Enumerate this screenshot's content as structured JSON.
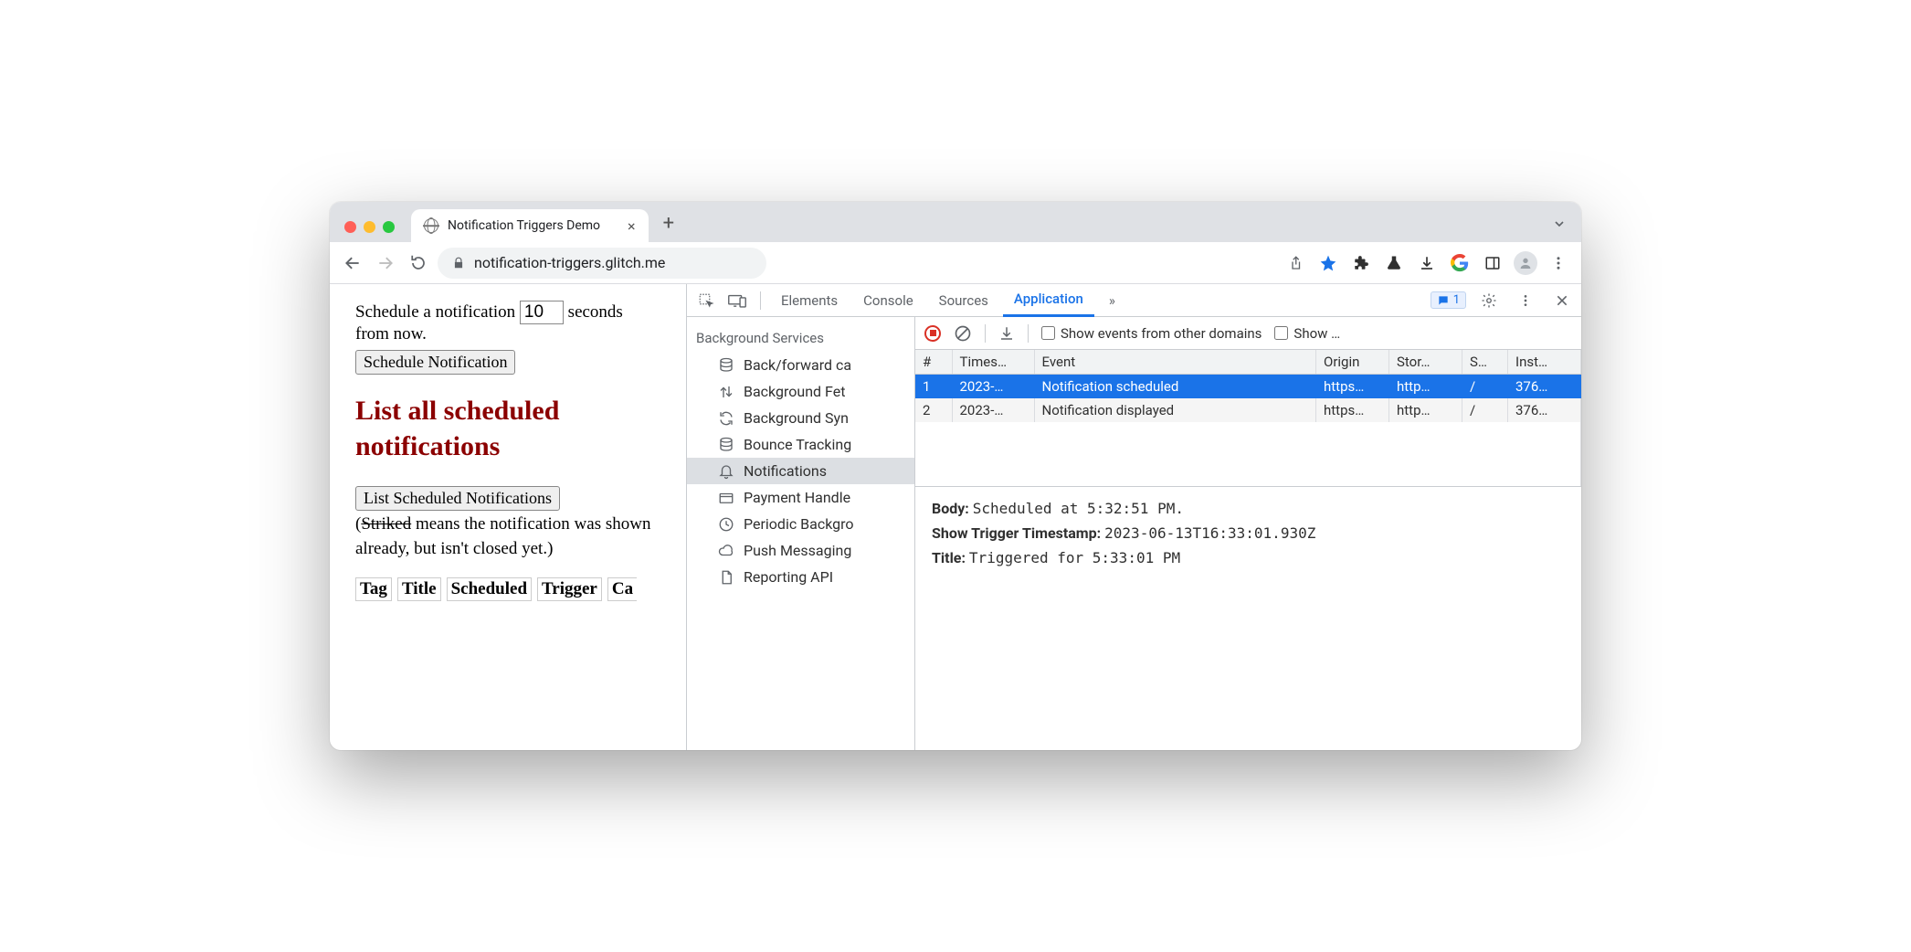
{
  "browser": {
    "tab_title": "Notification Triggers Demo",
    "url": "notification-triggers.glitch.me"
  },
  "page": {
    "schedule_label_a": "Schedule a notification ",
    "schedule_seconds": "10",
    "schedule_label_b": " seconds from now.",
    "schedule_button": "Schedule Notification",
    "heading": "List all scheduled notifications",
    "list_button": "List Scheduled Notifications",
    "hint_open": "(",
    "hint_striked": "Striked",
    "hint_rest": " means the notification was shown already, but isn't closed yet.)",
    "table_headers": [
      "Tag",
      "Title",
      "Scheduled",
      "Trigger",
      "Ca"
    ]
  },
  "devtools": {
    "tabs": [
      "Elements",
      "Console",
      "Sources",
      "Application"
    ],
    "active_tab": "Application",
    "more": "»",
    "issues_count": "1",
    "sidebar": {
      "group": "Background Services",
      "items": [
        {
          "icon": "db",
          "label": "Back/forward ca"
        },
        {
          "icon": "updown",
          "label": "Background Fet"
        },
        {
          "icon": "sync",
          "label": "Background Syn"
        },
        {
          "icon": "db",
          "label": "Bounce Tracking"
        },
        {
          "icon": "bell",
          "label": "Notifications",
          "selected": true
        },
        {
          "icon": "card",
          "label": "Payment Handle"
        },
        {
          "icon": "clock",
          "label": "Periodic Backgro"
        },
        {
          "icon": "cloud",
          "label": "Push Messaging"
        },
        {
          "icon": "file",
          "label": "Reporting API"
        }
      ]
    },
    "bar": {
      "check1": "Show events from other domains",
      "check2": "Show …"
    },
    "table": {
      "columns": [
        "#",
        "Times…",
        "Event",
        "Origin",
        "Stor…",
        "S…",
        "Inst…"
      ],
      "rows": [
        {
          "n": "1",
          "ts": "2023-…",
          "event": "Notification scheduled",
          "origin": "https…",
          "stor": "http…",
          "s": "/",
          "inst": "376…",
          "selected": true
        },
        {
          "n": "2",
          "ts": "2023-…",
          "event": "Notification displayed",
          "origin": "https…",
          "stor": "http…",
          "s": "/",
          "inst": "376…",
          "selected": false
        }
      ]
    },
    "details": {
      "body_label": "Body:",
      "body_value": "Scheduled at 5:32:51 PM.",
      "trigger_label": "Show Trigger Timestamp:",
      "trigger_value": "2023-06-13T16:33:01.930Z",
      "title_label": "Title:",
      "title_value": "Triggered for 5:33:01 PM"
    }
  }
}
